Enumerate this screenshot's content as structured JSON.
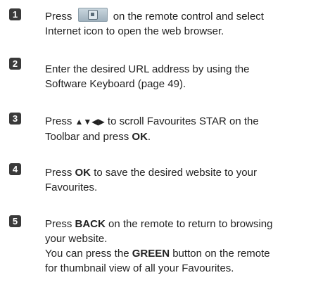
{
  "steps": [
    {
      "number": "1",
      "line1_before": "Press",
      "button_icon": "internet-remote-button-icon",
      "line1_after": "on the remote control and select",
      "line2": "Internet icon to open the web browser."
    },
    {
      "number": "2",
      "line1": "Enter the desired URL address by using the",
      "line2": "Software Keyboard (page 49)."
    },
    {
      "number": "3",
      "line1_before": "Press",
      "arrows": "▲▼◀▶",
      "line1_after": "to scroll Favourites STAR on the",
      "line2_before": "Toolbar and press",
      "line2_bold": "OK",
      "line2_after": "."
    },
    {
      "number": "4",
      "line1_before": "Press",
      "line1_bold": "OK",
      "line1_after": "to save the desired website to your",
      "line2": "Favourites."
    },
    {
      "number": "5",
      "line1_before": "Press",
      "line1_bold": "BACK",
      "line1_after": "on the remote to return to browsing",
      "line2": "your website.",
      "line3_before": "You can press the",
      "line3_bold": "GREEN",
      "line3_after": "button on the remote",
      "line4": "for thumbnail view of all your Favourites."
    }
  ]
}
